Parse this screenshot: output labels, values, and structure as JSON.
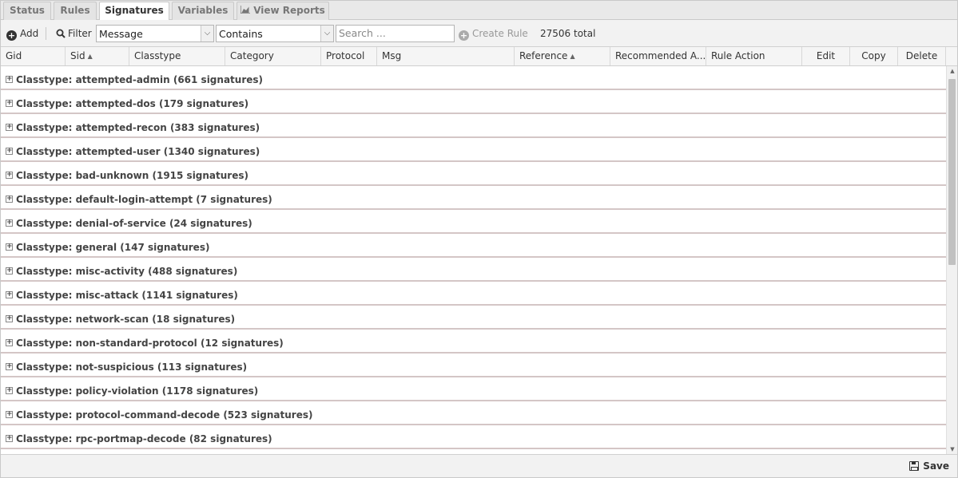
{
  "tabs": [
    {
      "label": "Status",
      "active": false
    },
    {
      "label": "Rules",
      "active": false
    },
    {
      "label": "Signatures",
      "active": true
    },
    {
      "label": "Variables",
      "active": false
    },
    {
      "label": "View Reports",
      "icon": "chart-icon",
      "active": false
    }
  ],
  "toolbar": {
    "add_label": "Add",
    "filter_label": "Filter",
    "field_value": "Message",
    "operator_value": "Contains",
    "search_placeholder": "Search ...",
    "create_rule_label": "Create Rule",
    "total_label": "27506 total"
  },
  "columns": [
    {
      "label": "Gid",
      "sort": ""
    },
    {
      "label": "Sid",
      "sort": "asc"
    },
    {
      "label": "Classtype",
      "sort": ""
    },
    {
      "label": "Category",
      "sort": ""
    },
    {
      "label": "Protocol",
      "sort": ""
    },
    {
      "label": "Msg",
      "sort": ""
    },
    {
      "label": "Reference",
      "sort": "asc"
    },
    {
      "label": "Recommended A...",
      "sort": ""
    },
    {
      "label": "Rule Action",
      "sort": ""
    },
    {
      "label": "Edit",
      "sort": ""
    },
    {
      "label": "Copy",
      "sort": ""
    },
    {
      "label": "Delete",
      "sort": ""
    }
  ],
  "groups": [
    "Classtype: attempted-admin (661 signatures)",
    "Classtype: attempted-dos (179 signatures)",
    "Classtype: attempted-recon (383 signatures)",
    "Classtype: attempted-user (1340 signatures)",
    "Classtype: bad-unknown (1915 signatures)",
    "Classtype: default-login-attempt (7 signatures)",
    "Classtype: denial-of-service (24 signatures)",
    "Classtype: general (147 signatures)",
    "Classtype: misc-activity (488 signatures)",
    "Classtype: misc-attack (1141 signatures)",
    "Classtype: network-scan (18 signatures)",
    "Classtype: non-standard-protocol (12 signatures)",
    "Classtype: not-suspicious (113 signatures)",
    "Classtype: policy-violation (1178 signatures)",
    "Classtype: protocol-command-decode (523 signatures)",
    "Classtype: rpc-portmap-decode (82 signatures)"
  ],
  "footer": {
    "save_label": "Save"
  }
}
